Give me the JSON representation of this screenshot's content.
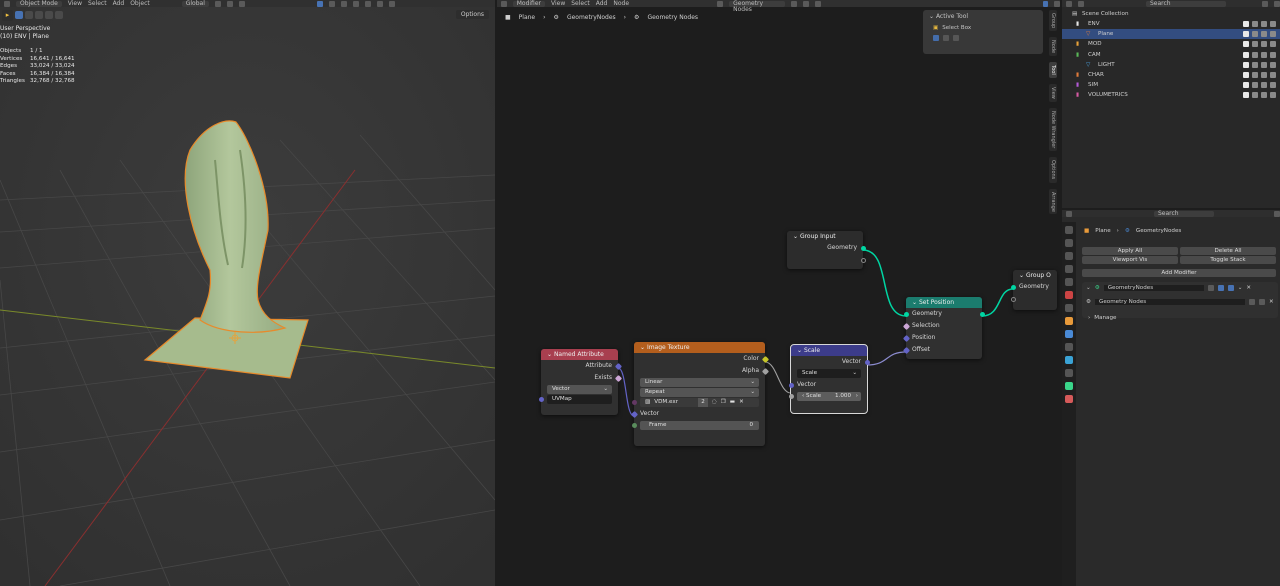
{
  "viewport": {
    "header": {
      "mode": "Object Mode",
      "menus": [
        "View",
        "Select",
        "Add",
        "Object"
      ],
      "orientation": "Global"
    },
    "overlay": {
      "line1": "User Perspective",
      "line2": "(10) ENV | Plane"
    },
    "stats": [
      {
        "k": "Objects",
        "v": "1 / 1"
      },
      {
        "k": "Vertices",
        "v": "16,641 / 16,641"
      },
      {
        "k": "Edges",
        "v": "33,024 / 33,024"
      },
      {
        "k": "Faces",
        "v": "16,384 / 16,384"
      },
      {
        "k": "Triangles",
        "v": "32,768 / 32,768"
      }
    ],
    "options_label": "Options"
  },
  "node_editor": {
    "header": {
      "editor": "Modifier",
      "menus": [
        "View",
        "Select",
        "Add",
        "Node"
      ],
      "tree": "Geometry Nodes"
    },
    "breadcrumb": [
      "Plane",
      "GeometryNodes",
      "Geometry Nodes"
    ],
    "side_tabs": [
      "Group",
      "Node",
      "Tool",
      "View",
      "Node Wrangler",
      "Options",
      "Arrange"
    ],
    "active_tool": {
      "title": "Active Tool",
      "item": "Select Box"
    },
    "nodes": {
      "group_input": {
        "title": "Group Input",
        "out": "Geometry"
      },
      "group_output": {
        "title": "Group O",
        "in": "Geometry"
      },
      "set_position": {
        "title": "Set Position",
        "rows": [
          "Geometry",
          "Selection",
          "Position",
          "Offset"
        ]
      },
      "named_attribute": {
        "title": "Named Attribute",
        "outs": [
          "Attribute",
          "Exists"
        ],
        "type": "Vector",
        "name": "UVMap"
      },
      "image_texture": {
        "title": "Image Texture",
        "outs": [
          "Color",
          "Alpha"
        ],
        "interp": "Linear",
        "ext": "Repeat",
        "image": "VDM.exr",
        "users": "2",
        "vector": "Vector",
        "frame_label": "Frame",
        "frame_val": "0"
      },
      "scale": {
        "title": "Scale",
        "out": "Vector",
        "op": "Scale",
        "in_vec": "Vector",
        "scale_label": "Scale",
        "scale_val": "1.000"
      }
    },
    "colors": {
      "geometry": "#00d6a3",
      "vector": "#6363c7",
      "color": "#c7c729",
      "set_position_header": "#1b7c6e",
      "image_texture_header": "#b35e1d",
      "named_attr_header": "#a83f4f",
      "scale_header": "#3c3c8a"
    }
  },
  "outliner": {
    "search_placeholder": "Search",
    "root": "Scene Collection",
    "items": [
      {
        "label": "ENV",
        "color": "#e8e8e8",
        "indent": 0
      },
      {
        "label": "Plane",
        "color": "#e07a3a",
        "indent": 1,
        "selected": true
      },
      {
        "label": "MOD",
        "color": "#e8a23a",
        "indent": 0
      },
      {
        "label": "CAM",
        "color": "#5ab858",
        "indent": 0
      },
      {
        "label": "LIGHT",
        "color": "#4aa3e0",
        "indent": 1
      },
      {
        "label": "CHAR",
        "color": "#e07a3a",
        "indent": 0
      },
      {
        "label": "SIM",
        "color": "#b35ad6",
        "indent": 0
      },
      {
        "label": "VOLUMETRICS",
        "color": "#d65aa3",
        "indent": 0
      }
    ]
  },
  "properties": {
    "search_placeholder": "Search",
    "breadcrumb": [
      "Plane",
      "GeometryNodes"
    ],
    "apply_all": "Apply All",
    "delete_all": "Delete All",
    "viewport_vis": "Viewport Vis",
    "toggle_stack": "Toggle Stack",
    "add_modifier": "Add Modifier",
    "modifier_name": "GeometryNodes",
    "node_group": "Geometry Nodes",
    "manage": "Manage"
  }
}
